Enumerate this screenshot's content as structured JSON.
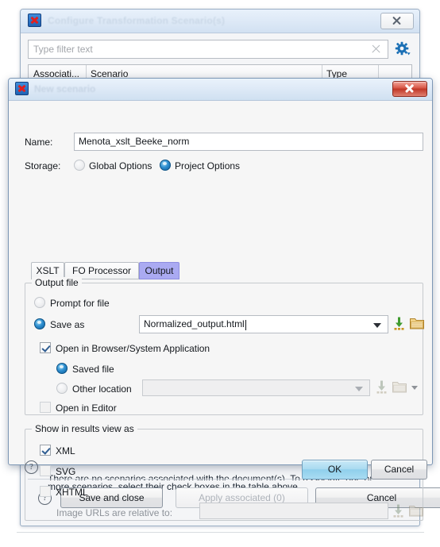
{
  "background_window": {
    "title": "Configure Transformation Scenario(s)",
    "app_icon": "oxygen-xml-icon",
    "close_label": "close-window",
    "filter": {
      "placeholder": "Type filter text",
      "value": "",
      "clear_icon": "clear-icon",
      "settings_icon": "gear-icon"
    },
    "table": {
      "columns": [
        "Associati...",
        "Scenario",
        "Type"
      ]
    },
    "note_line1": "There are no scenarios associated with the document(s). To associate one or",
    "note_line2": "more scenarios, select their check boxes in the table above.",
    "help_label": "?",
    "buttons": {
      "save_and_close": "Save and close",
      "apply_associated": "Apply associated (0)",
      "cancel": "Cancel"
    }
  },
  "dialog": {
    "title": "New scenario",
    "app_icon": "oxygen-xml-icon",
    "close_label": "close-dialog",
    "name": {
      "label": "Name:",
      "value": "Menota_xslt_Beeke_norm"
    },
    "storage": {
      "label": "Storage:",
      "options": [
        "Global Options",
        "Project Options"
      ],
      "selected": "Project Options"
    },
    "tabs": [
      {
        "label": "XSLT",
        "active": false
      },
      {
        "label": "FO Processor",
        "active": false
      },
      {
        "label": "Output",
        "active": true
      }
    ],
    "output_file": {
      "group_title": "Output file",
      "prompt_for_file": {
        "label": "Prompt for file",
        "selected": false
      },
      "save_as": {
        "label": "Save as",
        "selected": true,
        "value": "Normalized_output.html"
      },
      "save_as_insert_icon": "insert-variable-icon",
      "save_as_browse_icon": "folder-icon",
      "open_in_browser": {
        "label": "Open in Browser/System Application",
        "checked": true
      },
      "saved_file": {
        "label": "Saved file",
        "selected": true
      },
      "other_location": {
        "label": "Other location",
        "selected": false,
        "value": ""
      },
      "other_insert_icon": "insert-variable-icon",
      "other_browse_icon": "folder-icon",
      "other_browse_caret": "chevron-down-icon",
      "open_in_editor": {
        "label": "Open in Editor",
        "checked": false
      }
    },
    "results_view": {
      "group_title": "Show in results view as",
      "items": [
        {
          "label": "XML",
          "checked": true
        },
        {
          "label": "SVG",
          "checked": false
        },
        {
          "label": "XHTML",
          "checked": false
        }
      ],
      "image_urls": {
        "label": "Image URLs are relative to:",
        "value": "",
        "insert_icon": "insert-variable-icon",
        "browse_icon": "folder-icon"
      }
    },
    "help_label": "?",
    "buttons": {
      "ok": "OK",
      "cancel": "Cancel"
    }
  }
}
